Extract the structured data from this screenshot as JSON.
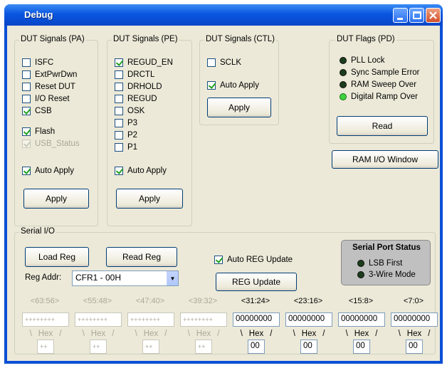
{
  "window": {
    "title": "Debug"
  },
  "pa": {
    "title": "DUT Signals (PA)",
    "items": [
      {
        "label": "ISFC",
        "checked": false
      },
      {
        "label": "ExtPwrDwn",
        "checked": false
      },
      {
        "label": "Reset DUT",
        "checked": false
      },
      {
        "label": "I/O Reset",
        "checked": false
      },
      {
        "label": "CSB",
        "checked": true
      },
      {
        "label": "Flash",
        "checked": true
      },
      {
        "label": "USB_Status",
        "checked": true
      }
    ],
    "auto_apply": "Auto Apply",
    "apply": "Apply"
  },
  "pe": {
    "title": "DUT Signals (PE)",
    "items": [
      {
        "label": "REGUD_EN",
        "checked": true
      },
      {
        "label": "DRCTL",
        "checked": false
      },
      {
        "label": "DRHOLD",
        "checked": false
      },
      {
        "label": "REGUD",
        "checked": false
      },
      {
        "label": "OSK",
        "checked": false
      },
      {
        "label": "P3",
        "checked": false
      },
      {
        "label": "P2",
        "checked": false
      },
      {
        "label": "P1",
        "checked": false
      }
    ],
    "auto_apply": "Auto Apply",
    "apply": "Apply"
  },
  "ctl": {
    "title": "DUT Signals (CTL)",
    "sclk": "SCLK",
    "auto_apply": "Auto Apply",
    "apply": "Apply"
  },
  "flags": {
    "title": "DUT Flags (PD)",
    "items": [
      {
        "label": "PLL Lock",
        "on": false
      },
      {
        "label": "Sync Sample Error",
        "on": false
      },
      {
        "label": "RAM Sweep Over",
        "on": false
      },
      {
        "label": "Digital Ramp Over",
        "on": true
      }
    ],
    "read": "Read"
  },
  "ram_window": "RAM I/O Window",
  "serial": {
    "title": "Serial I/O",
    "load_reg": "Load Reg",
    "read_reg": "Read Reg",
    "reg_addr_label": "Reg Addr:",
    "reg_addr_value": "CFR1 - 00H",
    "auto_reg_update": "Auto REG Update",
    "reg_update": "REG Update",
    "status_title": "Serial Port Status",
    "status_items": [
      "LSB First",
      "3-Wire Mode"
    ],
    "ranges": [
      "<63:56>",
      "<55:48>",
      "<47:40>",
      "<39:32>",
      "<31:24>",
      "<23:16>",
      "<15:8>",
      "<7:0>"
    ],
    "disabled_value": "++++++++",
    "values": [
      "00000000",
      "00000000",
      "00000000",
      "00000000"
    ],
    "hex_label": "Hex",
    "small_disabled": "++",
    "small_values": [
      "00",
      "00",
      "00",
      "00"
    ]
  }
}
